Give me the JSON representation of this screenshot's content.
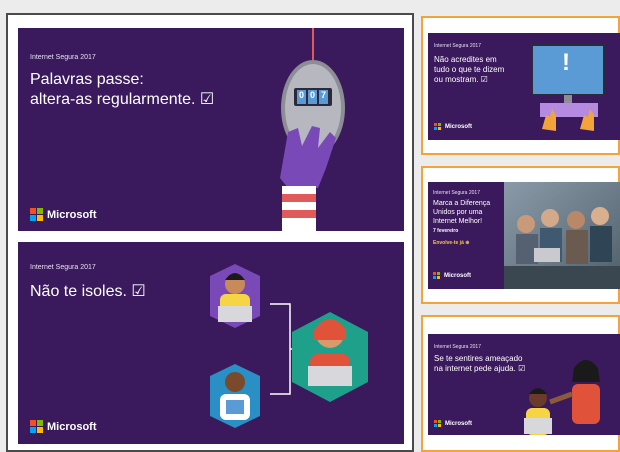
{
  "cards": {
    "passwords": {
      "tag": "Internet Segura 2017",
      "line1": "Palavras passe:",
      "line2": "altera-as regularmente. ☑",
      "logo": "Microsoft",
      "lock_digits": [
        "0",
        "0",
        "7"
      ]
    },
    "isolate": {
      "tag": "Internet Segura 2017",
      "headline": "Não te isoles. ☑",
      "logo": "Microsoft"
    },
    "believe": {
      "tag": "Internet Segura 2017",
      "line1": "Não acredites em",
      "line2": "tudo o que te dizem",
      "line3": "ou mostram. ☑",
      "logo": "Microsoft",
      "screen_symbol": "!"
    },
    "difference": {
      "tag": "Internet Segura 2017",
      "line1": "Marca a Diferença",
      "line2": "Unidos por uma",
      "line3": "Internet Melhor!",
      "date": "7 fevereiro",
      "cta": "Envolve-te já ⊕",
      "logo": "Microsoft"
    },
    "threatened": {
      "tag": "Internet Segura 2017",
      "line1": "Se te sentires ameaçado",
      "line2": "na internet pede ajuda. ☑",
      "logo": "Microsoft"
    }
  },
  "colors": {
    "card_bg": "#3a1a5c",
    "accent_orange": "#f2a33a",
    "ms_red": "#f25022",
    "ms_green": "#7fba00",
    "ms_blue": "#00a4ef",
    "ms_yellow": "#ffb900"
  },
  "icons": [
    "microsoft-logo",
    "padlock-mouse-icon",
    "monitor-alert-icon",
    "people-network-icon"
  ]
}
